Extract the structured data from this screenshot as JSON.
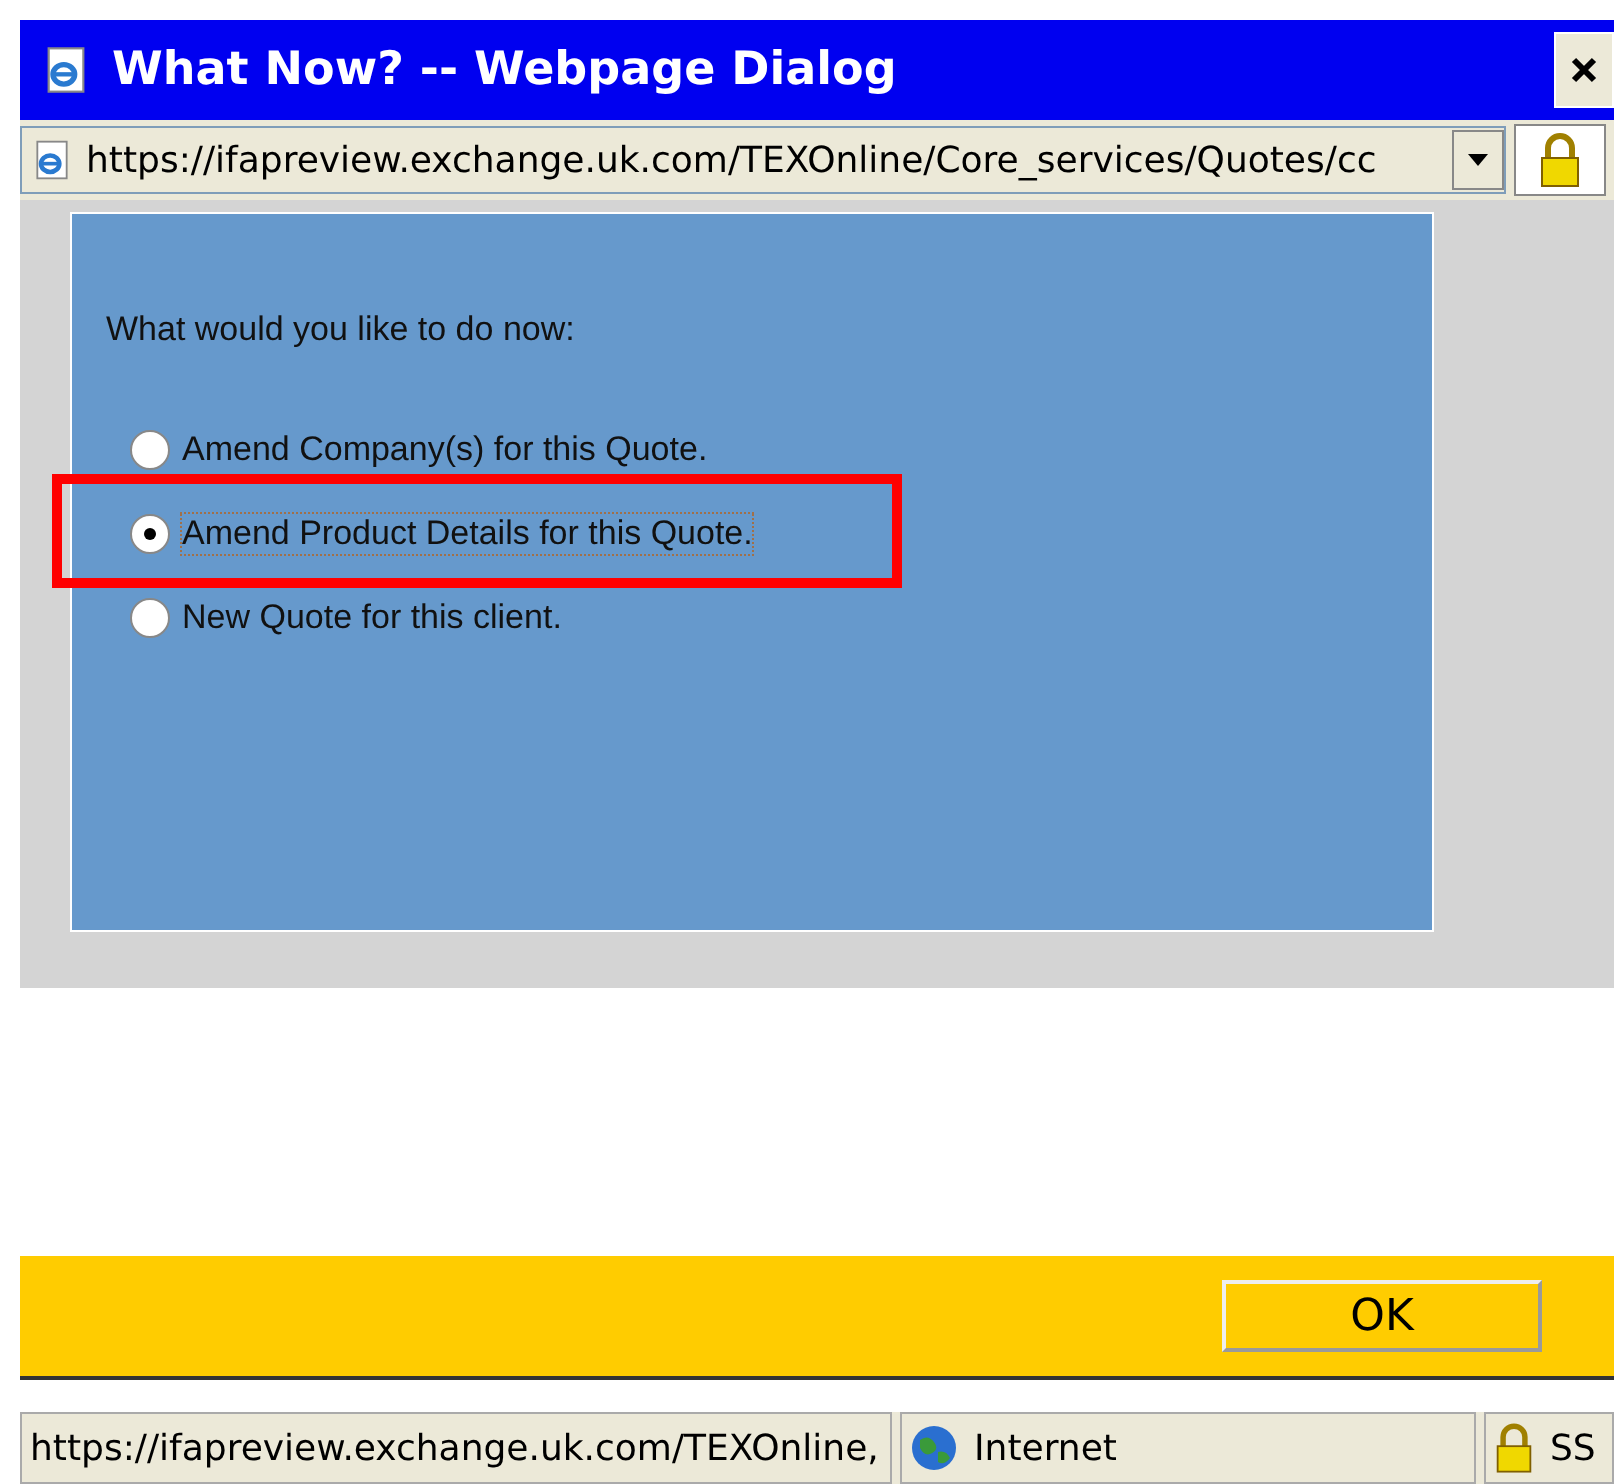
{
  "window": {
    "title": "What Now? -- Webpage Dialog"
  },
  "address_bar": {
    "url": "https://ifapreview.exchange.uk.com/TEXOnline/Core_services/Quotes/cc"
  },
  "prompt": "What would you like to do now:",
  "options": [
    {
      "label": "Amend Company(s) for this Quote.",
      "selected": false
    },
    {
      "label": "Amend Product Details for this Quote.",
      "selected": true
    },
    {
      "label": "New Quote for this client.",
      "selected": false
    }
  ],
  "buttons": [
    "OK"
  ],
  "status_bar": {
    "url": "https://ifapreview.exchange.uk.com/TEXOnline,",
    "zone": "Internet",
    "security": "SS"
  }
}
